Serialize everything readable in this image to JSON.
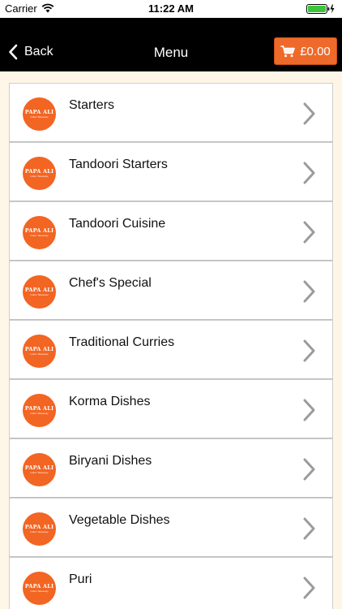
{
  "status_bar": {
    "carrier": "Carrier",
    "time": "11:22 AM",
    "wifi_icon": "wifi-icon",
    "battery_icon": "battery-charging-icon"
  },
  "nav": {
    "back_label": "Back",
    "title": "Menu",
    "cart_label": "£0.00",
    "cart_icon": "cart-icon"
  },
  "colors": {
    "nav_background": "#000000",
    "accent": "#ee6a2a",
    "page_background": "#fdf6e7",
    "logo_background": "#f26522"
  },
  "brand_logo": {
    "name": "PAPA ALI",
    "tagline": "Indian Takeaway"
  },
  "menu": {
    "items": [
      {
        "label": "Starters"
      },
      {
        "label": "Tandoori Starters"
      },
      {
        "label": "Tandoori Cuisine"
      },
      {
        "label": "Chef's Special"
      },
      {
        "label": "Traditional Curries"
      },
      {
        "label": "Korma Dishes"
      },
      {
        "label": "Biryani Dishes"
      },
      {
        "label": "Vegetable Dishes"
      },
      {
        "label": "Puri"
      }
    ]
  }
}
